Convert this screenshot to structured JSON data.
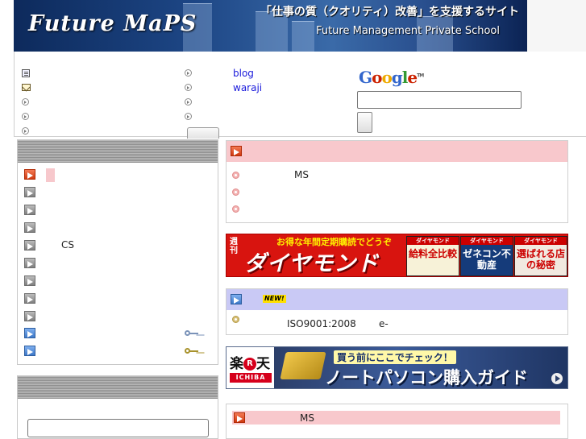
{
  "banner": {
    "logo": "Future MaPS",
    "tagline": "「仕事の質（クオリティ）改善」を支援するサイト",
    "subtitle": "Future Management Private School"
  },
  "topnav": {
    "links": [
      "blog",
      "waraji"
    ]
  },
  "search": {
    "logo_letters": [
      "G",
      "o",
      "o",
      "g",
      "l",
      "e"
    ],
    "trademark": "TM"
  },
  "left_menu": {
    "cs_label": "CS"
  },
  "right": {
    "box1_item1": "MS",
    "new_badge": "NEW!",
    "box2_item1": "ISO9001:2008",
    "box2_item1_suffix": "e-",
    "box3_item1": "MS"
  },
  "ads": {
    "diamond": {
      "shukan": "週刊",
      "headline": "お得な年間定期購読でどうぞ",
      "title": "ダイヤモンド",
      "mag1_top": "ダイヤモンド",
      "mag1_body": "給料全比較",
      "mag2_top": "ダイヤモンド",
      "mag2_body": "ゼネコン不動産",
      "mag3_top": "ダイヤモンド",
      "mag3_body": "選ばれる店の秘密"
    },
    "rakuten": {
      "brand_pre": "楽",
      "brand_circle": "R",
      "brand_post": "天",
      "ichiba": "ICHIBA",
      "line1": "買う前にここでチェック！",
      "line2": "ノートパソコン購入ガイド"
    }
  },
  "colors": {
    "banner_bg": "#1d4685",
    "link": "#1a1adb",
    "pink_header": "#f8c8cc",
    "blue_header": "#c9c9f5",
    "diamond_red": "#d8140f"
  }
}
